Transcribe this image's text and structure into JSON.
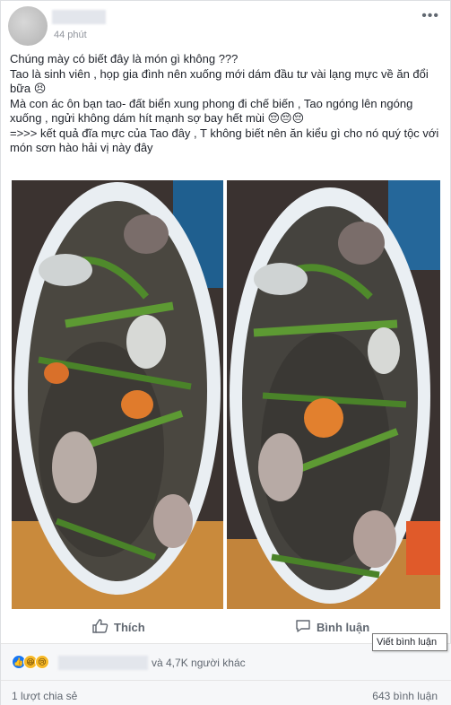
{
  "post": {
    "timestamp": "44 phút",
    "more_label": "•••",
    "text_lines": [
      "Chúng mày có biết đây là món gì không ???",
      "Tao là sinh viên , họp gia đình nên xuống mới dám đầu tư vài lạng mực về ăn đổi bữa 😣",
      "Mà con ác ôn bạn tao- đất biển xung phong đi chế biến , Tao ngóng lên ngóng xuống , ngửi không dám hít mạnh sợ bay hết mùi 😔😔😔",
      "=>>> kết quả đĩa mực của Tao đây , T không biết nên ăn kiểu gì cho nó quý tộc với món sơn hào hải vị này đây"
    ]
  },
  "actions": {
    "like_label": "Thích",
    "comment_label": "Bình luận",
    "tooltip": "Viết bình luận"
  },
  "footer": {
    "reactions": [
      "like-reaction",
      "haha-reaction",
      "sad-reaction"
    ],
    "others_label": "và 4,7K người khác",
    "shares_label": "1 lượt chia sẻ",
    "comments_label": "643 bình luận"
  },
  "colors": {
    "accent": "#1877f2",
    "secondary_text": "#606770"
  }
}
